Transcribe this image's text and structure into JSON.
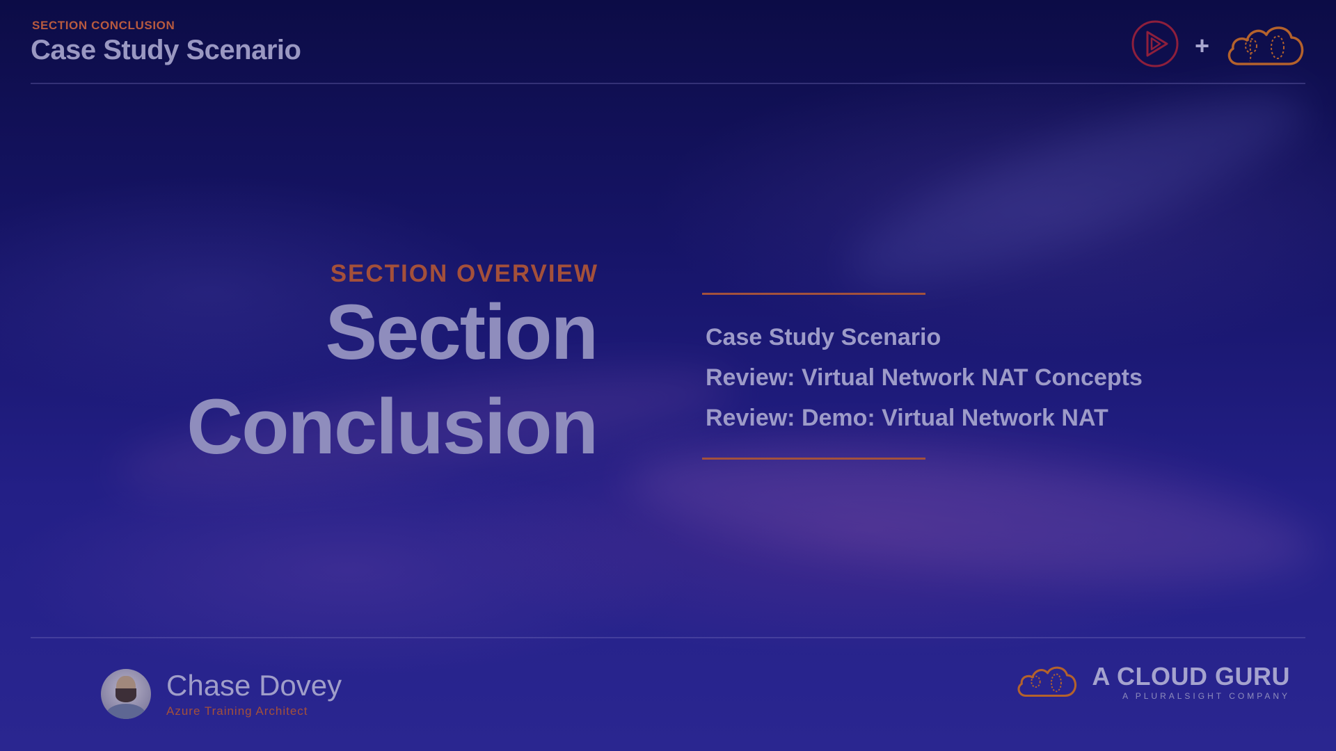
{
  "header": {
    "eyebrow": "SECTION CONCLUSION",
    "title": "Case Study Scenario",
    "plus": "+"
  },
  "overview": {
    "eyebrow": "SECTION OVERVIEW",
    "title_line1": "Section",
    "title_line2": "Conclusion"
  },
  "topics": [
    "Case Study Scenario",
    "Review: Virtual Network NAT Concepts",
    "Review: Demo: Virtual Network NAT"
  ],
  "presenter": {
    "name": "Chase Dovey",
    "role": "Azure Training Architect"
  },
  "brand": {
    "name": "A CLOUD GURU",
    "tagline": "A PLURALSIGHT COMPANY"
  },
  "icons": {
    "play": "play-logo-icon",
    "cloud": "cloud-guru-logo-icon"
  },
  "colors": {
    "accent": "#a4503a",
    "text": "#9d9bc8",
    "logo_red": "#8e1f3c",
    "logo_orange": "#b4622c"
  }
}
